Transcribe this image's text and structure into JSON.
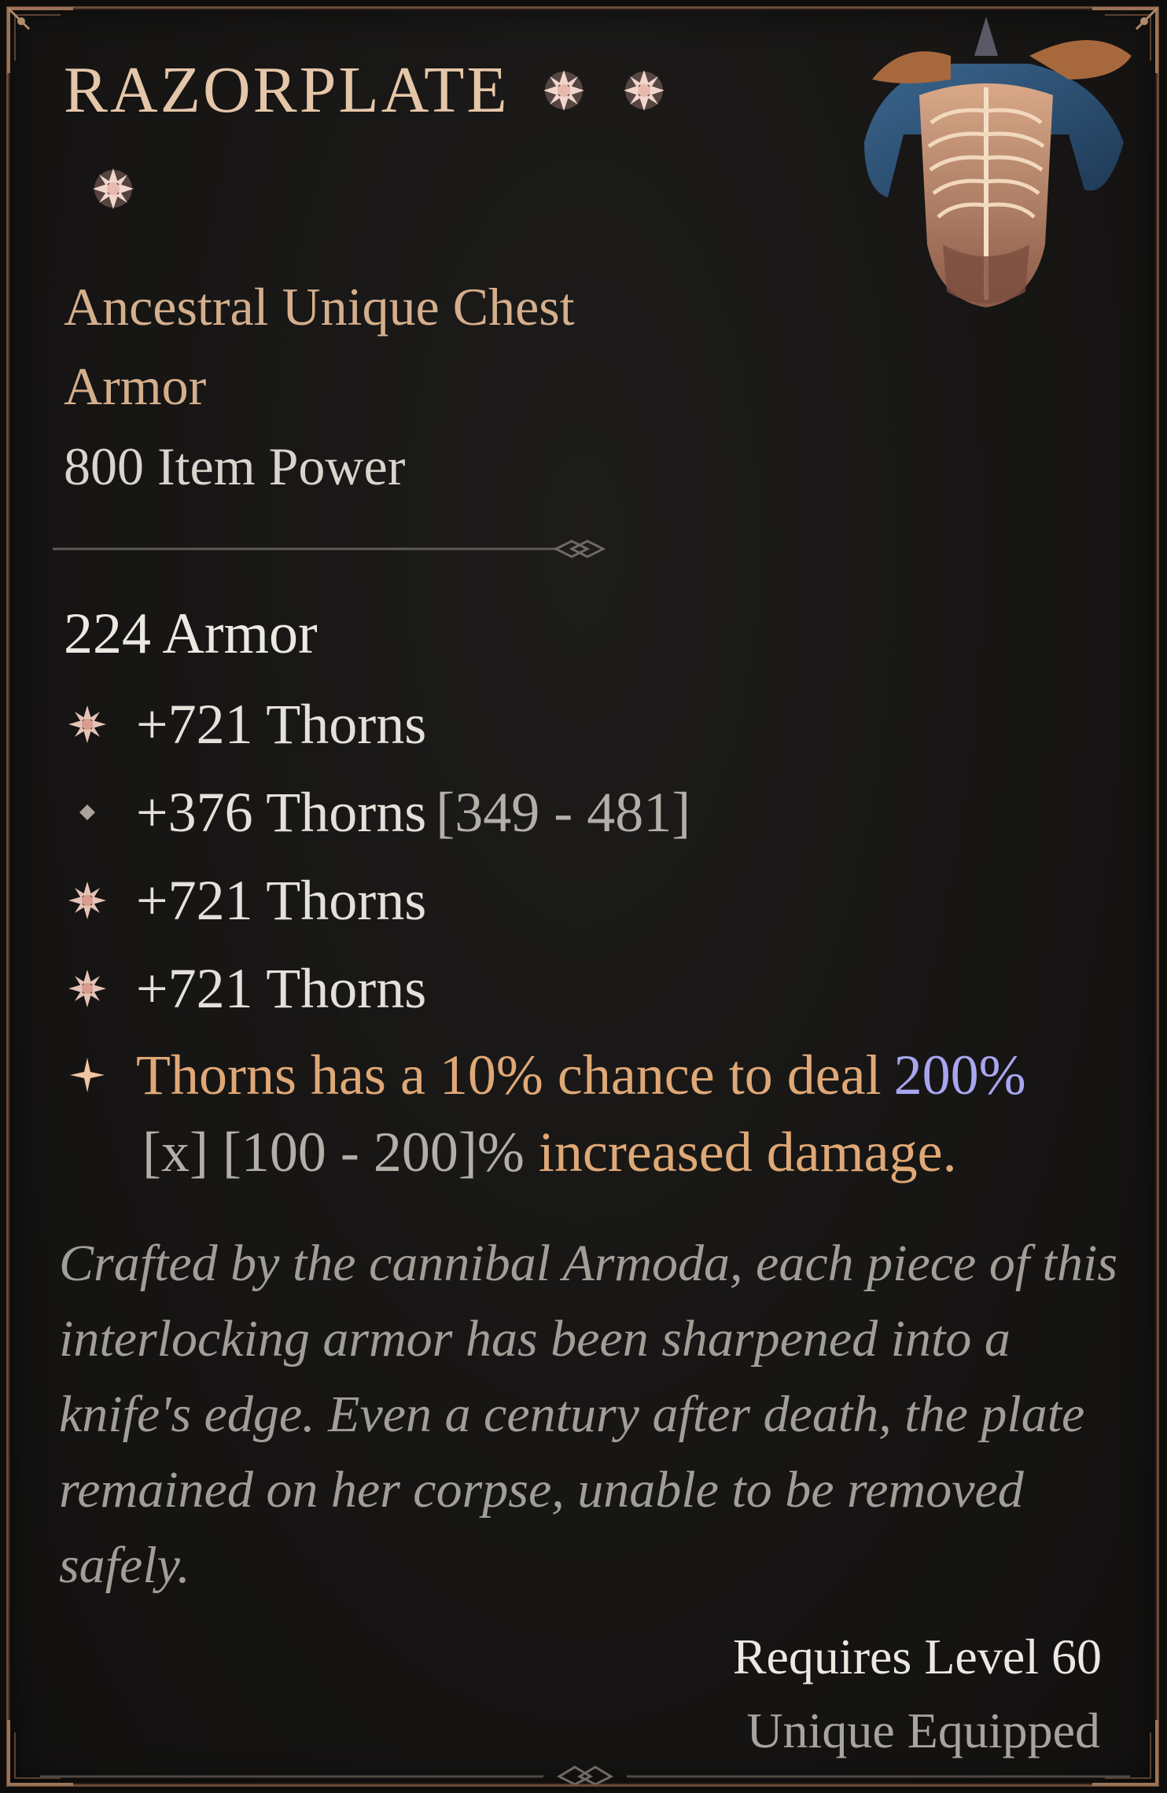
{
  "item": {
    "name": "RAZORPLATE",
    "type_line_1": "Ancestral Unique Chest",
    "type_line_2": "Armor",
    "item_power": "800 Item Power",
    "base_stat": "224 Armor",
    "image": "razorplate-chest-armor-icon"
  },
  "sockets": [
    {
      "icon": "socketed-gem-icon"
    },
    {
      "icon": "socketed-gem-icon"
    },
    {
      "icon": "socketed-gem-icon"
    }
  ],
  "affixes": [
    {
      "icon": "gem-affix-icon",
      "text": "+721 Thorns",
      "range": ""
    },
    {
      "icon": "affix-diamond-icon",
      "text": "+376 Thorns",
      "range": "[349 - 481]"
    },
    {
      "icon": "gem-affix-icon",
      "text": "+721 Thorns",
      "range": ""
    },
    {
      "icon": "gem-affix-icon",
      "text": "+721 Thorns",
      "range": ""
    }
  ],
  "unique_power": {
    "icon": "unique-star-icon",
    "text_start": "Thorns has a 10% chance to deal",
    "value": "200%",
    "value_multiplier": "[x] [100 - 200]%",
    "text_end": "increased damage."
  },
  "flavor_text": "Crafted by the cannibal Armoda, each piece of this interlocking armor has been sharpened into a knife's edge. Even a century after death, the plate remained on her corpse, unable to be removed safely.",
  "requirements": {
    "level": "Requires Level 60",
    "equip_rule": "Unique Equipped"
  },
  "colors": {
    "title": "#e6c6a8",
    "type": "#d5ae8c",
    "unique_text": "#e0a876",
    "value_blue": "#a9a6f0",
    "flavor": "#a19d97",
    "border": "#6b4a36"
  }
}
